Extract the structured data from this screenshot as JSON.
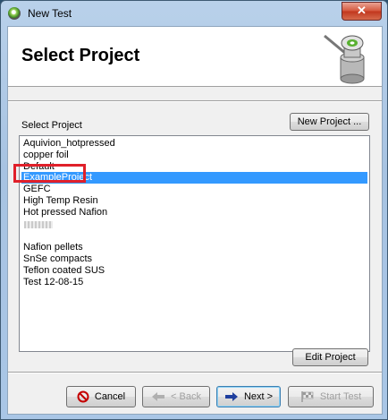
{
  "window": {
    "title": "New Test",
    "close_glyph": "✕"
  },
  "header": {
    "title": "Select Project",
    "image": "cell-device-image"
  },
  "project_section": {
    "label": "Select Project",
    "new_project_button": "New Project ...",
    "edit_project_button": "Edit Project",
    "items": [
      "Aquivion_hotpressed",
      "copper foil",
      "Default",
      "ExampleProject",
      "GEFC",
      "High Temp Resin",
      "Hot pressed Nafion",
      "",
      "Nafion pellets",
      "SnSe compacts",
      "Teflon coated SUS",
      "Test 12-08-15"
    ],
    "selected_item": "ExampleProject"
  },
  "footer": {
    "cancel": "Cancel",
    "back": "< Back",
    "next": "Next >",
    "start_test": "Start Test"
  },
  "colors": {
    "selection": "#3399ff",
    "annotation": "#e0202a"
  }
}
